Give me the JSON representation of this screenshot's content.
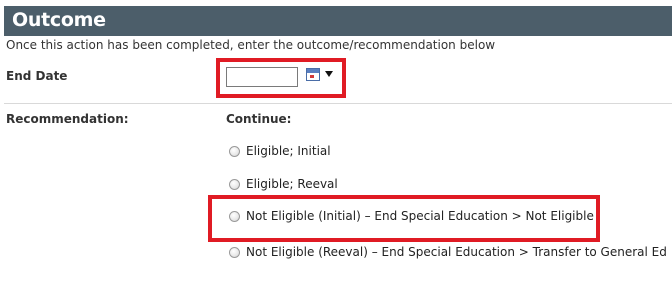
{
  "section": {
    "title": "Outcome",
    "instructions": "Once this action has been completed, enter the outcome/recommendation below"
  },
  "end_date": {
    "label": "End Date",
    "value": "",
    "calendar_icon": "calendar-icon",
    "dropdown_icon": "chevron-down-icon"
  },
  "recommendation": {
    "label": "Recommendation:",
    "group_label": "Continue:",
    "options": [
      {
        "label": "Eligible; Initial",
        "selected": false
      },
      {
        "label": "Eligible; Reeval",
        "selected": false
      },
      {
        "label": "Not Eligible (Initial) – End Special Education > Not Eligible",
        "selected": false
      },
      {
        "label": "Not Eligible (Reeval) – End Special Education > Transfer to General Ed",
        "selected": false
      }
    ]
  },
  "colors": {
    "header_bg": "#4c5e6a",
    "highlight": "#e01b24"
  }
}
